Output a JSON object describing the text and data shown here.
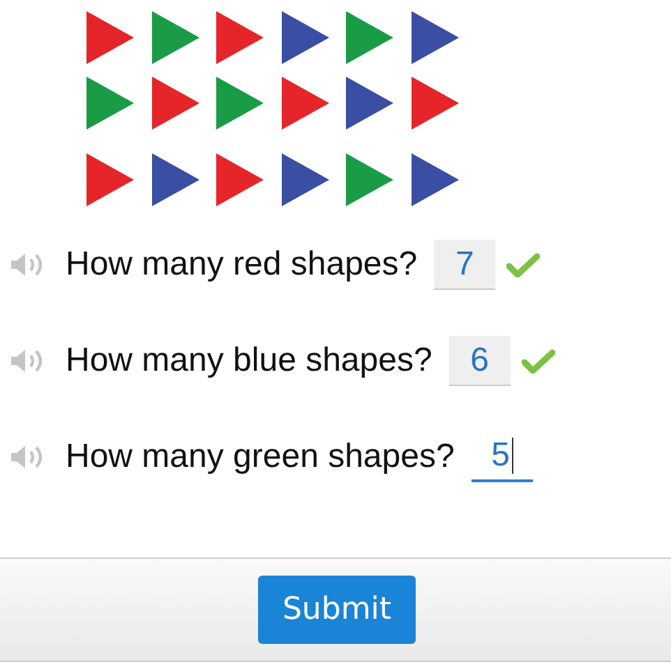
{
  "shapes": [
    [
      {
        "color": "#e52529"
      },
      {
        "color": "#1a9c47"
      },
      {
        "color": "#e52529"
      },
      {
        "color": "#3a4ea3"
      },
      {
        "color": "#1a9c47"
      },
      {
        "color": "#3a4ea3"
      }
    ],
    [
      {
        "color": "#1a9c47"
      },
      {
        "color": "#e52529"
      },
      {
        "color": "#1a9c47"
      },
      {
        "color": "#e52529"
      },
      {
        "color": "#3a4ea3"
      },
      {
        "color": "#e52529"
      }
    ],
    [
      {
        "color": "#e52529"
      },
      {
        "color": "#3a4ea3"
      },
      {
        "color": "#e52529"
      },
      {
        "color": "#3a4ea3"
      },
      {
        "color": "#1a9c47"
      },
      {
        "color": "#3a4ea3"
      }
    ]
  ],
  "questions": [
    {
      "text": "How many red shapes?",
      "answer": "7",
      "correct": true,
      "focused": false
    },
    {
      "text": "How many blue shapes?",
      "answer": "6",
      "correct": true,
      "focused": false
    },
    {
      "text": "How many green shapes?",
      "answer": "5",
      "correct": false,
      "focused": true
    }
  ],
  "submit": "Submit"
}
